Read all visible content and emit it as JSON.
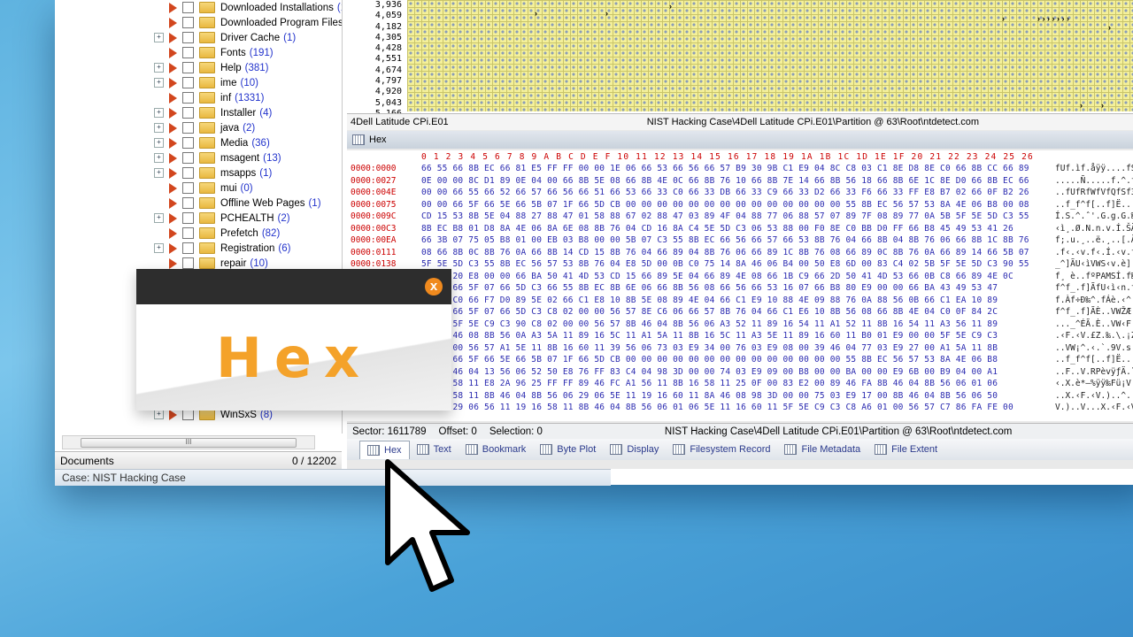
{
  "tree": {
    "items": [
      {
        "name": "Downloaded Installations",
        "count": "(1",
        "expander": false
      },
      {
        "name": "Downloaded Program Files",
        "count": "(",
        "expander": false
      },
      {
        "name": "Driver Cache",
        "count": "(1)",
        "expander": true
      },
      {
        "name": "Fonts",
        "count": "(191)",
        "expander": false
      },
      {
        "name": "Help",
        "count": "(381)",
        "expander": true
      },
      {
        "name": "ime",
        "count": "(10)",
        "expander": true
      },
      {
        "name": "inf",
        "count": "(1331)",
        "expander": false
      },
      {
        "name": "Installer",
        "count": "(4)",
        "expander": true
      },
      {
        "name": "java",
        "count": "(2)",
        "expander": true
      },
      {
        "name": "Media",
        "count": "(36)",
        "expander": true
      },
      {
        "name": "msagent",
        "count": "(13)",
        "expander": true
      },
      {
        "name": "msapps",
        "count": "(1)",
        "expander": true
      },
      {
        "name": "mui",
        "count": "(0)",
        "expander": false
      },
      {
        "name": "Offline Web Pages",
        "count": "(1)",
        "expander": false
      },
      {
        "name": "PCHEALTH",
        "count": "(2)",
        "expander": true
      },
      {
        "name": "Prefetch",
        "count": "(82)",
        "expander": false
      },
      {
        "name": "Registration",
        "count": "(6)",
        "expander": true
      },
      {
        "name": "repair",
        "count": "(10)",
        "expander": false
      }
    ],
    "last_item": {
      "name": "WinSxS",
      "count": "(8)"
    },
    "scroll_grip": "III"
  },
  "documents": {
    "label": "Documents",
    "count": "0 / 12202"
  },
  "status": {
    "case": "Case: NIST Hacking Case"
  },
  "graph": {
    "row_labels": [
      "3,936",
      "4,059",
      "4,182",
      "4,305",
      "4,428",
      "4,551",
      "4,674",
      "4,797",
      "4,920",
      "5,043",
      "5,166"
    ]
  },
  "evidence_bar": {
    "left": "4Dell Latitude CPi.E01",
    "path": "NIST Hacking Case\\4Dell Latitude CPi.E01\\Partition @ 63\\Root\\ntdetect.com"
  },
  "hex_panel": {
    "title": "Hex"
  },
  "hex": {
    "col_header": "0 1 2 3 4 5 6 7 8 9 A B C D E F 10 11 12 13 14 15 16 17 18 19 1A 1B 1C 1D 1E 1F 20 21 22 23 24 25 26",
    "offsets": [
      "0000:0000",
      "0000:0027",
      "0000:004E",
      "0000:0075",
      "0000:009C",
      "0000:00C3",
      "0000:00EA",
      "0000:0111",
      "0000:0138",
      "",
      "",
      "",
      "",
      "",
      "",
      "",
      "",
      "",
      "",
      "",
      "0000:030C"
    ],
    "rows": [
      "66 55 66 8B EC 66 81 E5 FF FF 00 00 1E 06 66 53 66 56 66 57 B9 30 9B C1 E9 04 8C C8 03 C1 8E D8 8E C0 66 8B CC 66 89",
      "0E 00 00 8C D1 89 0E 04 00 66 8B 5E 08 66 8B 4E 0C 66 8B 76 10 66 8B 7E 14 66 8B 56 18 66 8B 6E 1C 8E D0 66 8B EC 66",
      "00 00 66 55 66 52 66 57 66 56 66 51 66 53 66 33 C0 66 33 DB 66 33 C9 66 33 D2 66 33 F6 66 33 FF E8 B7 02 66 0F B2 26",
      "00 00 66 5F 66 5E 66 5B 07 1F 66 5D CB 00 00 00 00 00 00 00 00 00 00 00 00 00 00 55 8B EC 56 57 53 8A 4E 06 B8 00 08",
      "CD 15 53 8B 5E 04 88 27 88 47 01 58 88 67 02 88 47 03 89 4F 04 88 77 06 88 57 07 89 7F 08 89 77 0A 5B 5F 5E 5D C3 55",
      "8B EC B8 01 D8 8A 4E 06 8A 6E 08 8B 76 04 CD 16 8A C4 5E 5D C3 06 53 88 00 F0 8E C0 BB D0 FF 66 B8 45 49 53 41 26",
      "66 3B 07 75 05 B8 01 00 EB 03 B8 00 00 5B 07 C3 55 8B EC 66 56 66 57 66 53 8B 76 04 66 8B 04 8B 76 06 66 8B 1C 8B 76",
      "08 66 8B 0C 8B 76 0A 66 8B 14 CD 15 8B 76 04 66 89 04 8B 76 06 66 89 1C 8B 76 08 66 89 0C 8B 76 0A 66 89 14 66 5B 07",
      "5F 5E 5D C3 55 8B EC 56 57 53 8B 76 04 E8 5D 00 0B C0 75 14 8A 46 06 B4 00 50 E8 6D 00 83 C4 02 5B 5F 5E 5D C3 90 55",
      "66 B8 20 E8 00 00 66 BA 50 41 4D 53 CD 15 66 89 5E 04 66 89 4E 08 66 1B C9 66 2D 50 41 4D 53 66 0B C8 66 89 4E 0C",
      "66 5E 66 5F 07 66 5D C3 66 55 8B EC 8B 6E 06 66 8B 56 08 66 56 66 53 16 07 66 B8 80 E9 00 00 66 BA 43 49 53 47",
      "66 1B C0 66 F7 D0 89 5E 02 66 C1 E8 10 8B 5E 08 89 4E 04 66 C1 E9 10 88 4E 09 88 76 0A 88 56 0B 66 C1 EA 10 89",
      "66 5E 66 5F 07 66 5D C3 C8 02 00 00 56 57 8E C6 06 66 57 8B 76 04 66 C1 E6 10 8B 56 08 66 8B 4E 04 C0 0F 84 2C",
      "00 00 5F 5E C9 C3 90 C8 02 00 00 56 57 8B 46 04 8B 56 06 A3 52 11 89 16 54 11 A1 52 11 8B 16 54 11 A3 56 11 89",
      "11 8B 46 08 8B 56 0A A3 5A 11 89 16 5C 11 A1 5A 11 8B 16 5C 11 A3 5E 11 89 16 60 11 B0 01 E9 00 00 5F 5E C9 C3",
      "06 00 00 56 57 A1 5E 11 8B 16 60 11 39 56 06 73 03 E9 34 00 76 03 E9 08 00 39 46 04 77 03 E9 27 00 A1 5A 11 8B",
      "00 00 66 5F 66 5E 66 5B 07 1F 66 5D CB 00 00 00 00 00 00 00 00 00 00 00 00 00 00 55 8B EC 56 57 53 8A 4E 06 B8",
      "11 03 46 04 13 56 06 52 50 E8 76 FF 83 C4 04 98 3D 00 00 74 03 E9 09 00 B8 00 00 BA 00 00 E9 6B 00 B9 04 00 A1",
      "8B 16 58 11 E8 2A 96 25 FF FF 89 46 FC A1 56 11 8B 16 58 11 25 0F 00 83 E2 00 89 46 FA 8B 46 04 8B 56 06 01 06",
      "11 16 58 11 8B 46 04 8B 56 06 29 06 5E 11 19 16 60 11 8A 46 08 98 3D 00 00 75 03 E9 17 00 8B 46 04 8B 56 06 50",
      "56 06 29 06 56 11 19 16 58 11 8B 46 04 8B 56 06 01 06 5E 11 16 60 11 5F 5E C9 C3 C8 A6 01 00 56 57 C7 86 FA FE 00"
    ],
    "ascii": [
      "fUf.ìf.åÿÿ....fSfV",
      ".....Ñ.....f.^.f.N",
      "..fUfRfWfVfQfSf3Àf3",
      "..f_f^f[..f]Ë......",
      "Í.S.^.ˆ'.G.g.G.‰O.",
      "‹ì¸.Ø.N.n.v.Í.ŠÄ^]",
      "f;.u.¸..ë.¸..[.ÃU‹ì",
      ".f‹.‹v.f‹.Í.‹v.f‰",
      "_^]ÃU‹ìVWS‹v.è]..",
      "f¸ è..fºPAMSÍ.f‰^.",
      "f^f_.f]ÃfU‹ì‹n.f‹V",
      "f.Àf÷Ð‰^.fÁè.‹^.‰N",
      "f^f_.f]ÃÈ..VWŽÆ.fW",
      "..._^ÉÃ.È..VW‹F.‹V",
      ".‹F.‹V.£Z.‰.\\.¡Z.",
      "..VW¡^.‹.`.9V.s.é",
      "..f_f^f[..f]Ë.....",
      "..F..V.RPèvÿƒÄ.˜=",
      "‹.X.è*–%ÿÿ‰Fü¡V.‹",
      "..X.‹F.‹V.)..^...",
      "V.)..V...X.‹F.‹V."
    ]
  },
  "sector_bar": {
    "sector": "Sector: 1611789",
    "offset": "Offset: 0",
    "selection": "Selection: 0",
    "path": "NIST Hacking Case\\4Dell Latitude CPi.E01\\Partition @ 63\\Root\\ntdetect.com"
  },
  "tabs": [
    "Hex",
    "Text",
    "Bookmark",
    "Byte Plot",
    "Display",
    "Filesystem Record",
    "File Metadata",
    "File Extent"
  ],
  "overlay": {
    "title": "Hex",
    "close": "x"
  },
  "colors": {
    "accent": "#f4a22a",
    "hex_offsets": "#cc0000",
    "hex_bytes": "#2a2ab0",
    "tree_count": "#2233cc"
  }
}
